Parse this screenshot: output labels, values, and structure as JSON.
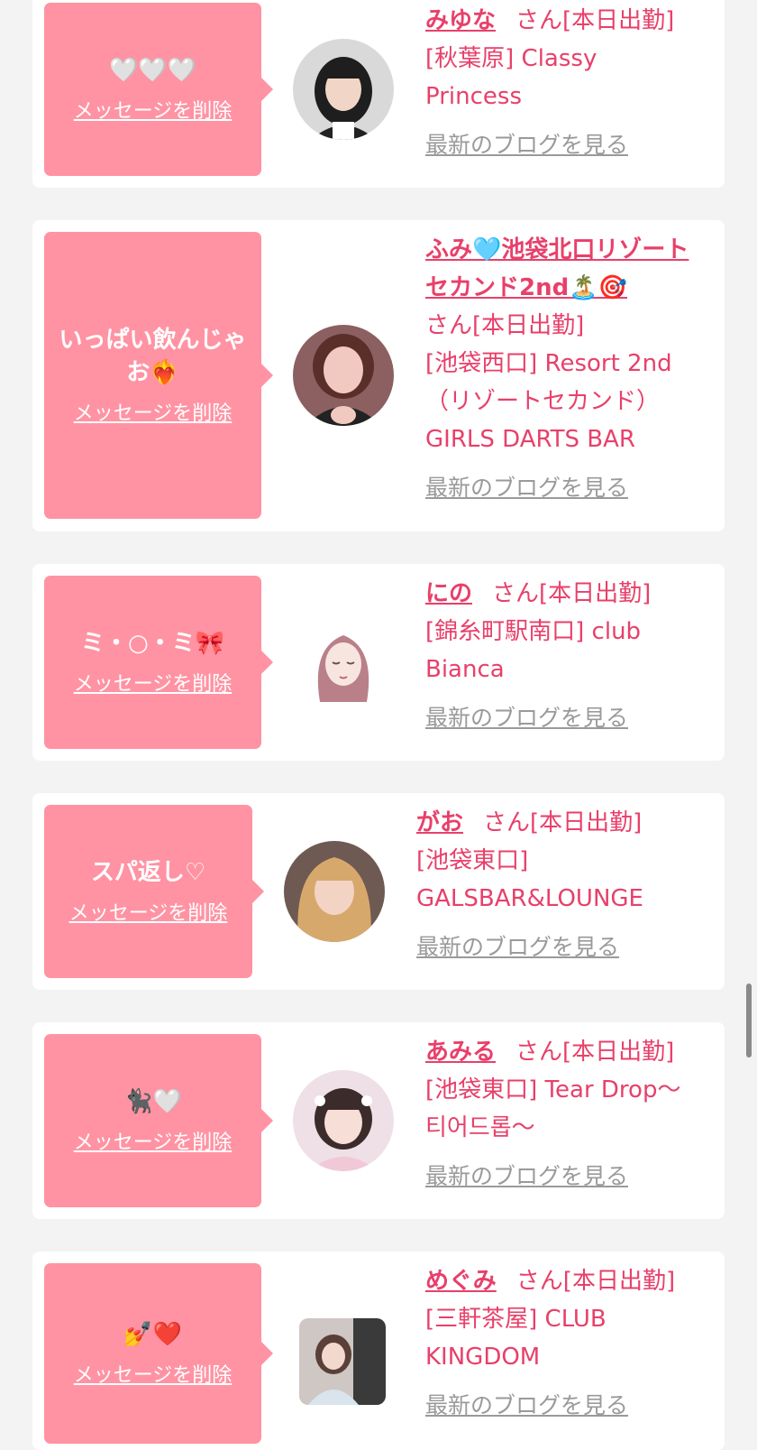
{
  "common": {
    "delete_label": "メッセージを削除",
    "blog_label": "最新のブログを見る",
    "san": "さん",
    "status": "[本日出勤]"
  },
  "colors": {
    "page_bg": "#f3f3f3",
    "bubble_pink": "#ff93a3",
    "accent_text": "#e8406a",
    "link_gray": "#9a9a9a"
  },
  "cards": [
    {
      "message": "🤍🤍🤍",
      "name": "みゆな",
      "shop": "[秋葉原] Classy Princess"
    },
    {
      "message": "いっぱい飲んじゃお❤️‍🔥",
      "name": "ふみ🩵池袋北口リゾートセカンド2nd🏝️🎯",
      "shop": "[池袋西口] Resort 2nd（リゾートセカンド）GIRLS DARTS BAR"
    },
    {
      "message": "ミ・○・ミ🎀",
      "name": "にの",
      "shop": "[錦糸町駅南口] club Bianca"
    },
    {
      "message": "スパ返し♡",
      "name": "がお",
      "shop": "[池袋東口] GALSBAR&LOUNGE"
    },
    {
      "message": "🐈‍⬛🤍",
      "name": "あみる",
      "shop": "[池袋東口] Tear Drop〜티어드롭〜"
    },
    {
      "message": "💅❤️",
      "name": "めぐみ",
      "shop": "[三軒茶屋] CLUB KINGDOM"
    }
  ]
}
